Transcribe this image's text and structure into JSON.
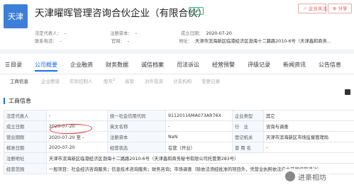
{
  "header": {
    "logo_text": "天津",
    "company_name": "天津曜晖管理咨询合伙企业（有限合伙）",
    "status": "在业",
    "follow_label": "☆ 企业关注",
    "share_label": "⊕ 分享",
    "info_row1": {
      "legal_rep_label": "法定代表人：",
      "legal_rep": "-",
      "reg_capital_label": "注册资本：",
      "reg_capital": "-",
      "founded_label": "成立日期：",
      "founded": "2020-07-20"
    },
    "info_row2": {
      "phone_label": "联系电话：",
      "phone": "-",
      "website_label": "官网：",
      "website": "-",
      "address_label": "地址：",
      "address": "天津市滨海新区临港经济区渤海十二路路2010-6号（天津鑫和商务..."
    }
  },
  "nav": {
    "items": [
      "目录",
      "公司概要",
      "企业融资",
      "财务数据",
      "诚信档案",
      "司法诉讼",
      "经营预警",
      "评级记录",
      "新闻资讯",
      "公告信息"
    ]
  },
  "subtabs": [
    {
      "label": "工商信息",
      "count": ""
    },
    {
      "label": "企业图谱",
      "count": ""
    },
    {
      "label": "实际控制人",
      "count": ""
    },
    {
      "label": "股东",
      "count": "2"
    },
    {
      "label": "高管",
      "count": ""
    },
    {
      "label": "对外投资",
      "count": ""
    },
    {
      "label": "分支机构",
      "count": ""
    },
    {
      "label": "变更记录",
      "count": ""
    }
  ],
  "section_title": "工商信息",
  "table": {
    "rows": [
      [
        "法定代表人",
        "-",
        "统一社会信用代码",
        "91120116MA073AR76X",
        "企业类型",
        "其它"
      ],
      [
        "成立日期",
        "2020-07-20",
        "英文名称",
        "-",
        "行　业",
        "咨询与调查"
      ],
      [
        "营业期限",
        "2020-07-20 至 -",
        "注册资本",
        "NaN",
        "登记机关",
        "天津市滨海新区市场监督管理局"
      ],
      [
        "核准日期",
        "2020-07-20",
        "经营状态",
        "在营（开业）",
        "曾 用 名",
        "-"
      ],
      [
        "注册地址",
        "天津市滨海新区临港经济区渤海十二路路2010-6号（天津鑫和商务秘书有限公司托管第283号）",
        "",
        "",
        "",
        ""
      ],
      [
        "经营范围",
        "一般项目：社会经济咨询服务；信息技术咨询服务；财务咨询；市场调查（除依法须经批准的项目外，凭营业执照依法自主开展经营活动）",
        "",
        "",
        "",
        ""
      ]
    ]
  },
  "watermark": "进豪相坊"
}
